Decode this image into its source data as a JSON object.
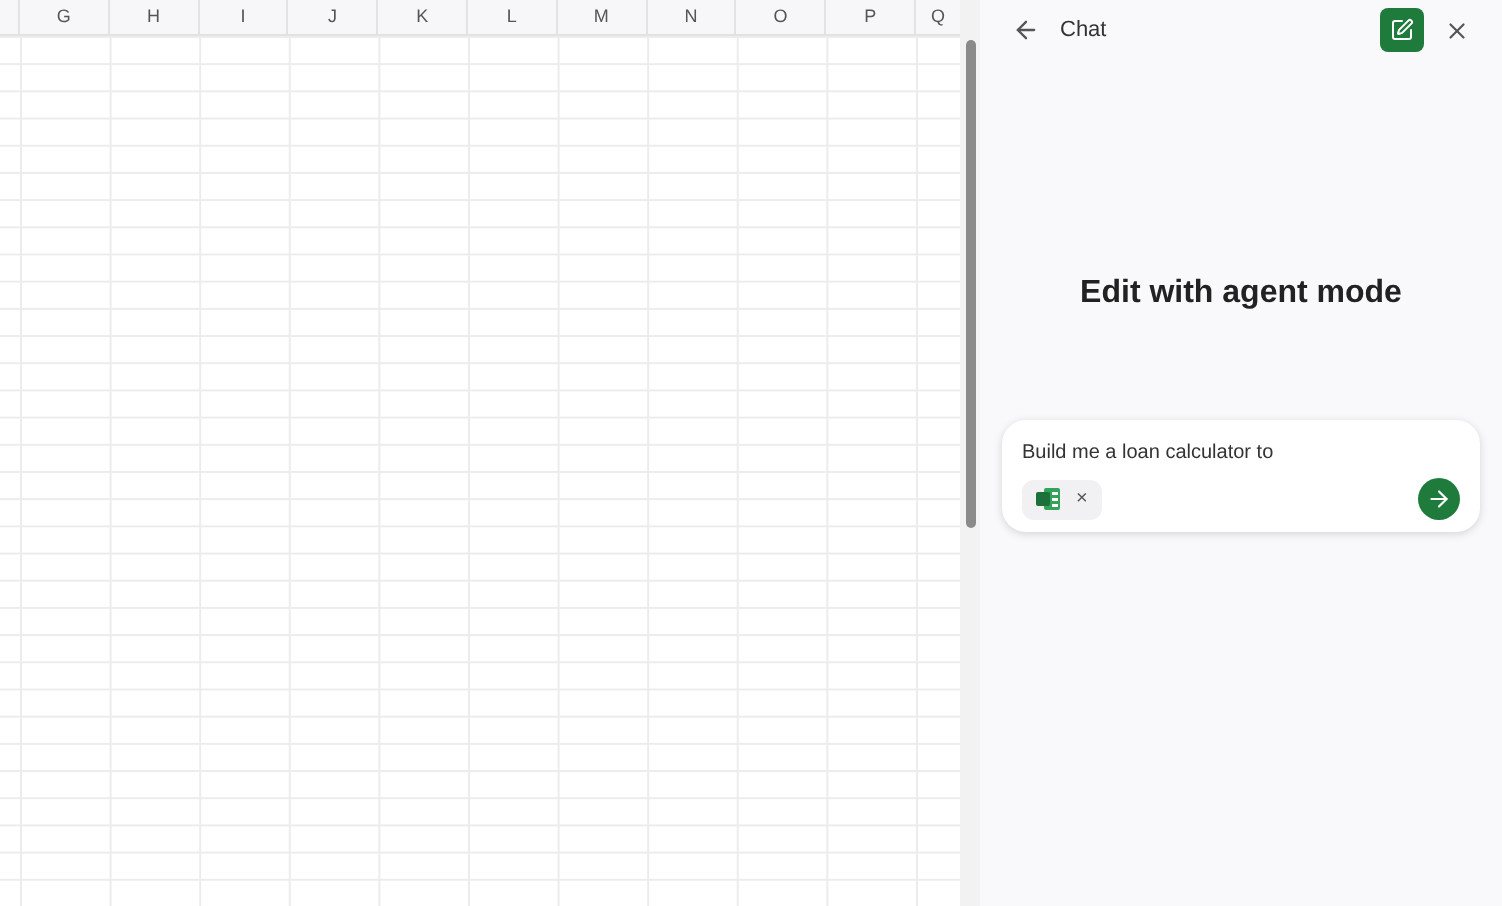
{
  "sheet": {
    "columns": [
      "G",
      "H",
      "I",
      "J",
      "K",
      "L",
      "M",
      "N",
      "O",
      "P",
      "Q"
    ]
  },
  "chat": {
    "title": "Chat",
    "heading": "Edit with agent mode",
    "input": {
      "value": "Build me a loan calculator to"
    },
    "attachment": {
      "remove": "×"
    }
  }
}
